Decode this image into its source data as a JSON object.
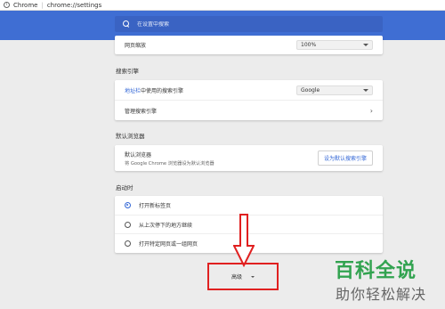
{
  "browser": {
    "app_name": "Chrome",
    "url": "chrome://settings"
  },
  "search": {
    "placeholder": "在设置中搜索"
  },
  "appearance": {
    "page_zoom_label": "网页缩放",
    "page_zoom_value": "100%"
  },
  "search_engine": {
    "title": "搜索引擎",
    "address_bar_prefix": "地址栏",
    "address_bar_suffix": "中使用的搜索引擎",
    "engine_value": "Google",
    "manage_label": "管理搜索引擎"
  },
  "default_browser": {
    "title": "默认浏览器",
    "label": "默认浏览器",
    "description": "将 Google Chrome 浏览器设为默认浏览器",
    "button": "设为默认搜索引擎"
  },
  "on_startup": {
    "title": "启动时",
    "options": [
      {
        "label": "打开新标签页",
        "checked": true
      },
      {
        "label": "从上次停下的地方继续",
        "checked": false
      },
      {
        "label": "打开特定网页或一组网页",
        "checked": false
      }
    ]
  },
  "advanced": {
    "label": "高级"
  },
  "watermark": {
    "title": "百科全说",
    "subtitle": "助你轻松解决"
  },
  "colors": {
    "header": "#3f6ed3",
    "accent": "#3367d6",
    "annotation": "#e02020",
    "watermark": "#32a350"
  }
}
